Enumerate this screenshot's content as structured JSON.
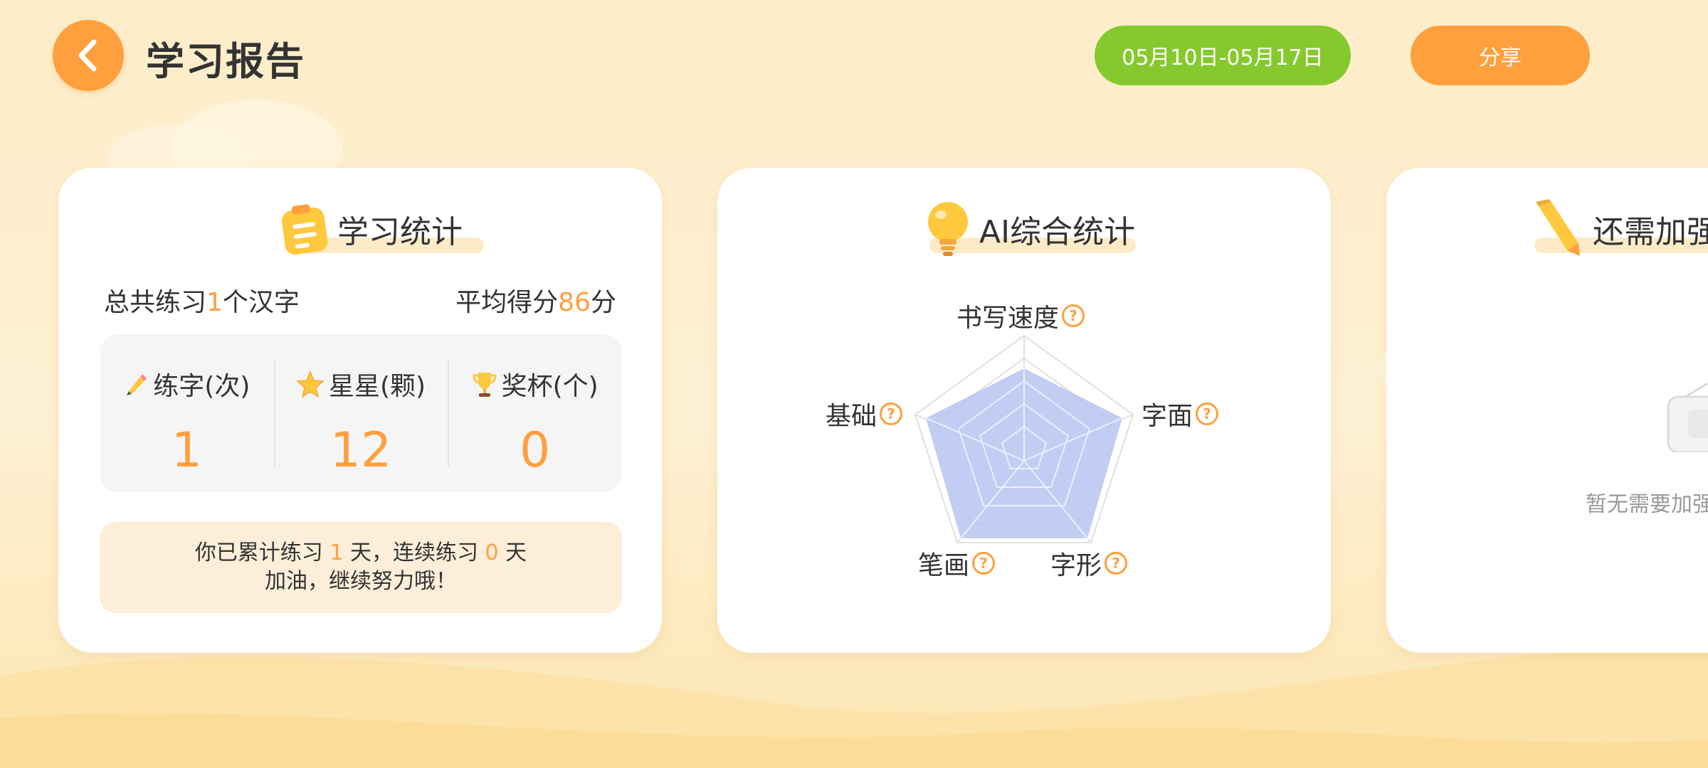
{
  "header": {
    "title": "学习报告",
    "date_range": "05月10日-05月17日",
    "share_label": "分享"
  },
  "study_stats": {
    "title": "学习统计",
    "summary_left": {
      "prefix": "总共练习",
      "value": "1",
      "suffix": "个汉字"
    },
    "summary_right": {
      "prefix": "平均得分",
      "value": "86",
      "suffix": "分"
    },
    "items": [
      {
        "label": "练字(次)",
        "value": "1",
        "icon": "pencil-icon"
      },
      {
        "label": "星星(颗)",
        "value": "12",
        "icon": "star-icon"
      },
      {
        "label": "奖杯(个)",
        "value": "0",
        "icon": "trophy-icon"
      }
    ],
    "message": {
      "l1_a": "你已累计练习 ",
      "l1_b": "1",
      "l1_c": " 天，连续练习 ",
      "l1_d": "0",
      "l1_e": " 天",
      "l2": "加油，继续努力哦！"
    }
  },
  "ai_stats": {
    "title": "AI综合统计",
    "axes": [
      "书写速度",
      "字面",
      "字形",
      "笔画",
      "基础"
    ],
    "help_icon": "?"
  },
  "weak_chars": {
    "title": "还需加强",
    "empty_text": "暂无需要加强"
  },
  "colors": {
    "accent": "#ff9f3d",
    "green": "#86c92e",
    "radar_fill": "#b7c4f2"
  }
}
